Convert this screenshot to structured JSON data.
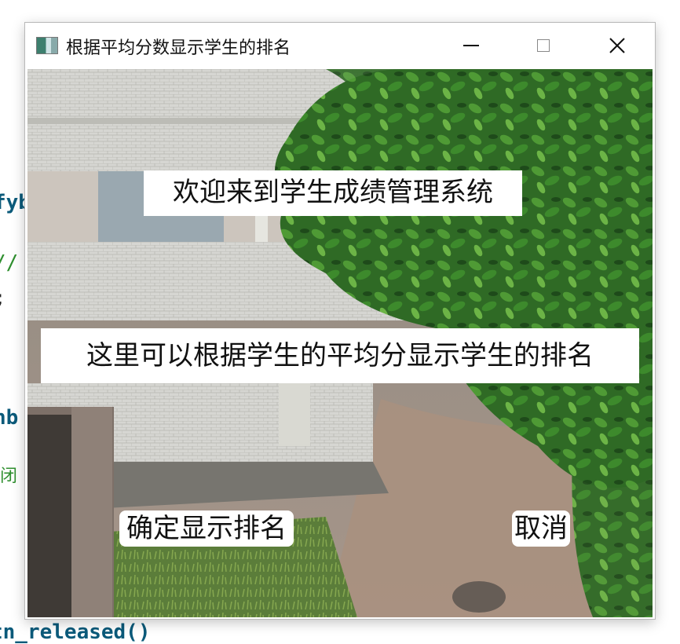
{
  "editor": {
    "line1": "fyb",
    "line2": "//",
    "line3": ";",
    "line4": "hb",
    "line5": "闭",
    "line6": "tn_released()"
  },
  "window": {
    "title": "根据平均分数显示学生的排名",
    "minimize_label": "",
    "close_label": "✕"
  },
  "content": {
    "welcome": "欢迎来到学生成绩管理系统",
    "description": "这里可以根据学生的平均分显示学生的排名",
    "confirm_button": "确定显示排名",
    "cancel_button": "取消"
  }
}
